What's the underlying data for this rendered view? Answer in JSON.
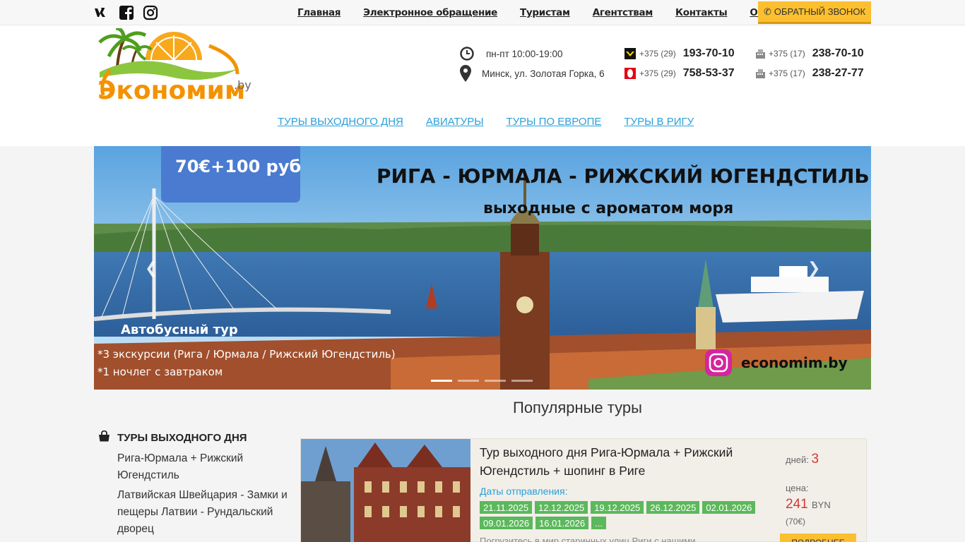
{
  "topnav": {
    "items": [
      "Главная",
      "Электронное обращение",
      "Туристам",
      "Агентствам",
      "Контакты",
      "Оплата"
    ],
    "callback_label": "ОБРАТНЫЙ ЗВОНОК"
  },
  "social": [
    "vk-icon",
    "facebook-icon",
    "instagram-icon"
  ],
  "logo": {
    "text": "Экономим",
    "suffix": ".by"
  },
  "contacts": {
    "hours": "пн-пт 10:00-19:00",
    "address": "Минск, ул. Золотая Горка, 6",
    "phones": [
      {
        "code": "+375 (29)",
        "number": "193-70-10",
        "operator": "velcom"
      },
      {
        "code": "+375 (29)",
        "number": "758-53-37",
        "operator": "mts"
      },
      {
        "code": "+375 (17)",
        "number": "238-70-10",
        "operator": "landline"
      },
      {
        "code": "+375 (17)",
        "number": "238-27-77",
        "operator": "landline"
      }
    ]
  },
  "mainnav": [
    "ТУРЫ ВЫХОДНОГО ДНЯ",
    "АВИАТУРЫ",
    "ТУРЫ ПО ЕВРОПЕ",
    "ТУРЫ В РИГУ"
  ],
  "banner": {
    "price_tag": "70€+100 руб",
    "title": "РИГА - ЮРМАЛА - РИЖСКИЙ ЮГЕНДСТИЛЬ",
    "subtitle": "выходные с ароматом моря",
    "type": "Автобусный тур",
    "bullets": [
      "*3 экскурсии (Рига / Юрмала / Рижский Югендстиль)",
      "*1 ночлег с завтраком"
    ],
    "brand": "economim.by",
    "slides_total": 4,
    "active_slide": 1
  },
  "popular": {
    "title": "Популярные туры"
  },
  "sidebar": {
    "heading": "ТУРЫ ВЫХОДНОГО ДНЯ",
    "items": [
      "Рига-Юрмала + Рижский Югендстиль",
      "Латвийская Швейцария - Замки и пещеры Латвии - Рундальский дворец"
    ]
  },
  "tour": {
    "title": "Тур выходного дня Рига-Юрмала + Рижский Югендстиль + шопинг в Риге",
    "dates_label": "Даты отправления:",
    "dates": [
      "21.11.2025",
      "12.12.2025",
      "19.12.2025",
      "26.12.2025",
      "02.01.2026",
      "09.01.2026",
      "16.01.2026",
      "..."
    ],
    "description": "Погрузитесь в мир старинных улиц Риги с нашими",
    "days_label": "дней:",
    "days": "3",
    "price_label": "цена:",
    "price": "241",
    "currency": "BYN",
    "price_eur": "(70€)",
    "more_label": "ПОДРОБНЕЕ"
  },
  "colors": {
    "accent_blue": "#2a9fd8",
    "button_yellow": "#fbbf2f",
    "date_green": "#5cb85c",
    "price_red": "#d23a3a"
  }
}
